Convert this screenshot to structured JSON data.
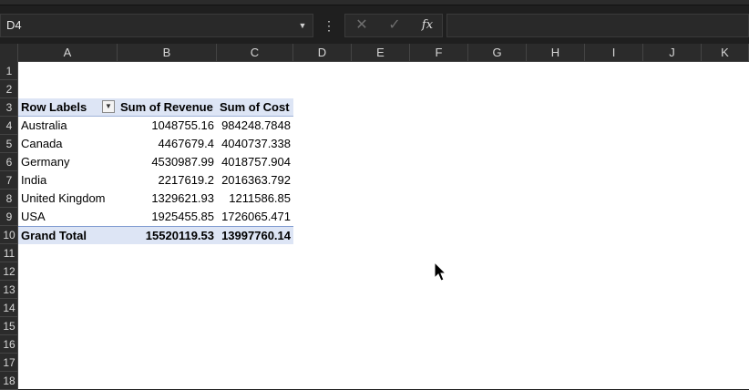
{
  "formula_bar": {
    "name_box": "D4",
    "name_box_dropdown": "▼",
    "menu_glyph": "⋮",
    "cancel_glyph": "✕",
    "enter_glyph": "✓",
    "fx_glyph": "fx",
    "formula": ""
  },
  "columns": [
    "A",
    "B",
    "C",
    "D",
    "E",
    "F",
    "G",
    "H",
    "I",
    "J",
    "K"
  ],
  "rows": [
    "1",
    "2",
    "3",
    "4",
    "5",
    "6",
    "7",
    "8",
    "9",
    "10",
    "11",
    "12",
    "13",
    "14",
    "15",
    "16",
    "17",
    "18"
  ],
  "pivot": {
    "header": {
      "row_labels": "Row Labels",
      "revenue": "Sum of Revenue",
      "cost": "Sum of Cost"
    },
    "filter_glyph": "▼",
    "rows": [
      {
        "label": "Australia",
        "revenue": "1048755.16",
        "cost": "984248.7848"
      },
      {
        "label": "Canada",
        "revenue": "4467679.4",
        "cost": "4040737.338"
      },
      {
        "label": "Germany",
        "revenue": "4530987.99",
        "cost": "4018757.904"
      },
      {
        "label": "India",
        "revenue": "2217619.2",
        "cost": "2016363.792"
      },
      {
        "label": "United Kingdom",
        "revenue": "1329621.93",
        "cost": "1211586.85"
      },
      {
        "label": "USA",
        "revenue": "1925455.85",
        "cost": "1726065.471"
      }
    ],
    "total": {
      "label": "Grand Total",
      "revenue": "15520119.53",
      "cost": "13997760.14"
    }
  },
  "colors": {
    "pivot_header_fill": "#dde5f5",
    "app_bg": "#1f1f1f",
    "grid_bg": "#ffffff"
  },
  "icons": {
    "cancel": "close-icon",
    "enter": "check-icon",
    "function": "fx-icon",
    "cursor": "mouse-pointer-icon"
  }
}
